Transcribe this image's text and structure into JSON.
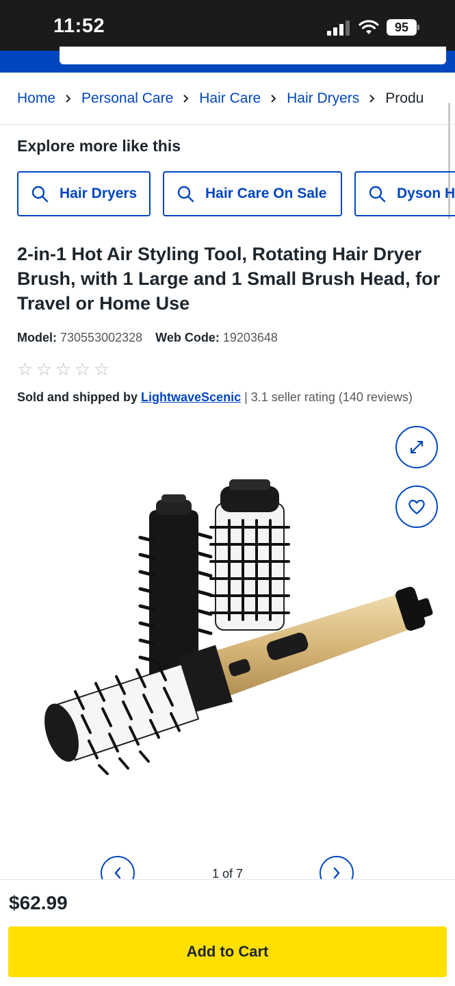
{
  "status_bar": {
    "time": "11:52",
    "battery": "95"
  },
  "breadcrumb": {
    "items": [
      "Home",
      "Personal Care",
      "Hair Care",
      "Hair Dryers"
    ],
    "current": "Produ"
  },
  "explore": {
    "title": "Explore more like this",
    "chips": [
      "Hair Dryers",
      "Hair Care On Sale",
      "Dyson H"
    ]
  },
  "product": {
    "title": "2-in-1 Hot Air Styling Tool, Rotating Hair Dryer Brush, with 1 Large and 1 Small Brush Head, for Travel or Home Use",
    "model_label": "Model:",
    "model": "730553002328",
    "web_code_label": "Web Code:",
    "web_code": "19203648",
    "rating_stars": 0,
    "sold_by_label": "Sold and shipped by",
    "seller": "LightwaveScenic",
    "seller_rating": "| 3.1 seller rating (140 reviews)"
  },
  "gallery": {
    "counter": "1 of 7"
  },
  "purchase": {
    "price": "$62.99",
    "add_to_cart": "Add to Cart"
  },
  "colors": {
    "brand_blue": "#0046be",
    "cart_yellow": "#ffe000",
    "status_bar": "#1b1b1b"
  }
}
